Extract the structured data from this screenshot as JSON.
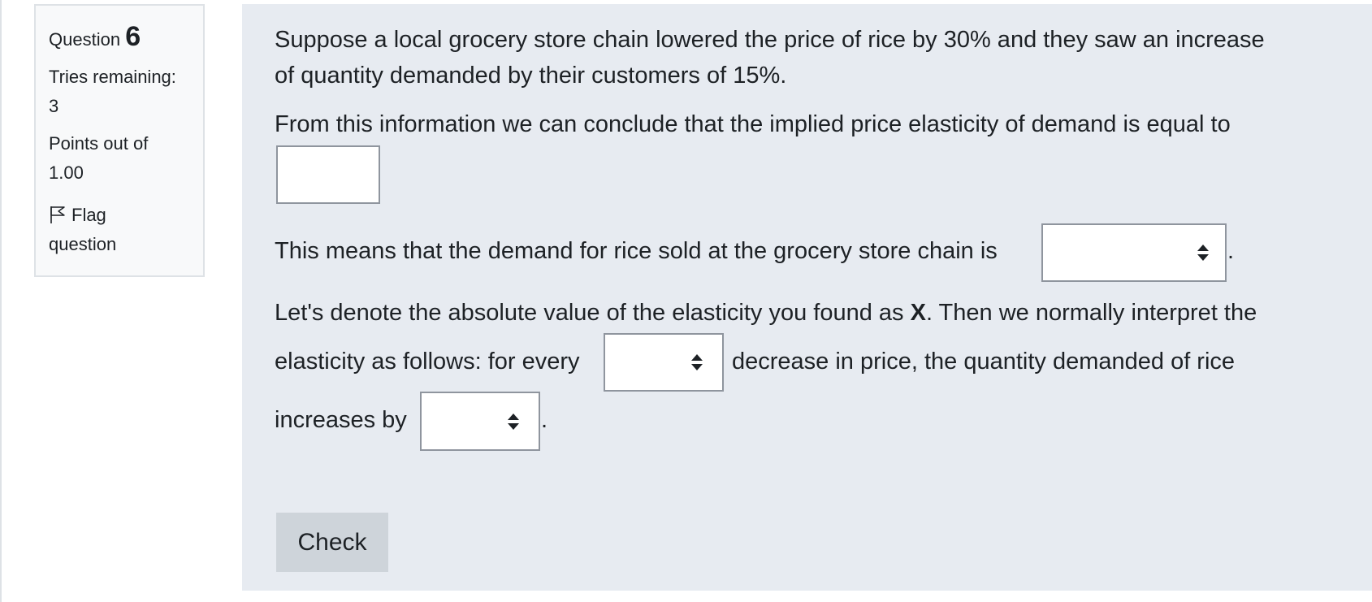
{
  "info": {
    "question_label": "Question",
    "question_number": "6",
    "tries_line1": "Tries remaining:",
    "tries_line2": "3",
    "points_line1": "Points out of",
    "points_line2": "1.00",
    "flag_line1": "Flag",
    "flag_line2": "question"
  },
  "question": {
    "p1_line1": "Suppose a local grocery store chain lowered the price of rice by 30% and they saw an increase",
    "p1_line2": "of quantity demanded by their customers of 15%.",
    "p2": "From this information we can conclude that the implied price elasticity of demand is equal to",
    "elasticity_value": "",
    "p3": "This means that the demand for rice sold at the grocery store chain is",
    "demand_type_selected": "",
    "p4_pre": "Let's denote the absolute value of the elasticity you found as ",
    "p4_var": "X",
    "p4_post": ". Then we normally interpret the",
    "p5_pre": "elasticity as follows: for every",
    "price_change_selected": "",
    "p5_post": "decrease in price, the quantity demanded of rice",
    "p6_pre": "increases by",
    "quantity_change_selected": "",
    "period": "."
  },
  "actions": {
    "check_label": "Check"
  }
}
